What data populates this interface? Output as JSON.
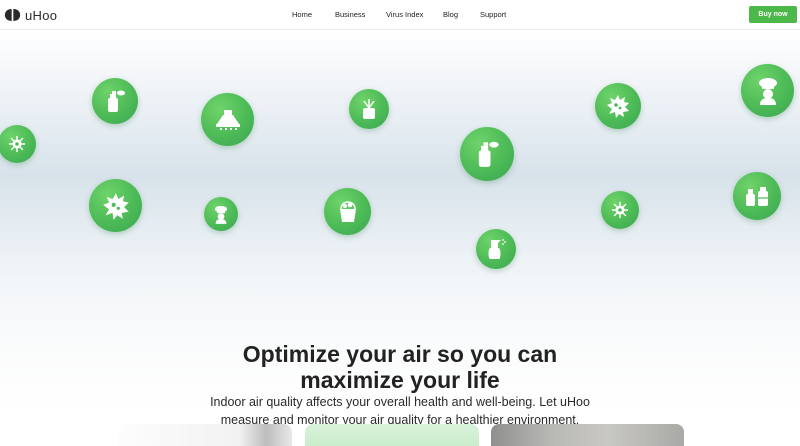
{
  "brand": {
    "name": "uHoo"
  },
  "nav": {
    "links": [
      "Home",
      "Business",
      "Virus Index",
      "Blog",
      "Support"
    ],
    "cta": "Buy now"
  },
  "hero": {
    "headline_line1": "Optimize your air so you can",
    "headline_line2": "maximize your life",
    "subtext_line1": "Indoor air quality affects your overall health and well-being. Let uHoo",
    "subtext_line2": "measure and monitor your air quality for a healthier environment.",
    "bubble_icons": [
      "virus-icon",
      "spray-can-icon",
      "range-hood-icon",
      "air-freshener-icon",
      "spray-can-icon",
      "mold-icon",
      "chef-icon",
      "mold-icon",
      "chef-icon",
      "cleaning-bucket-icon",
      "spray-bottle-icon",
      "virus-icon",
      "cleaning-products-icon"
    ]
  },
  "colors": {
    "accent": "#4cb849",
    "bubble_green": "#4cba56",
    "text_dark": "#222222"
  }
}
